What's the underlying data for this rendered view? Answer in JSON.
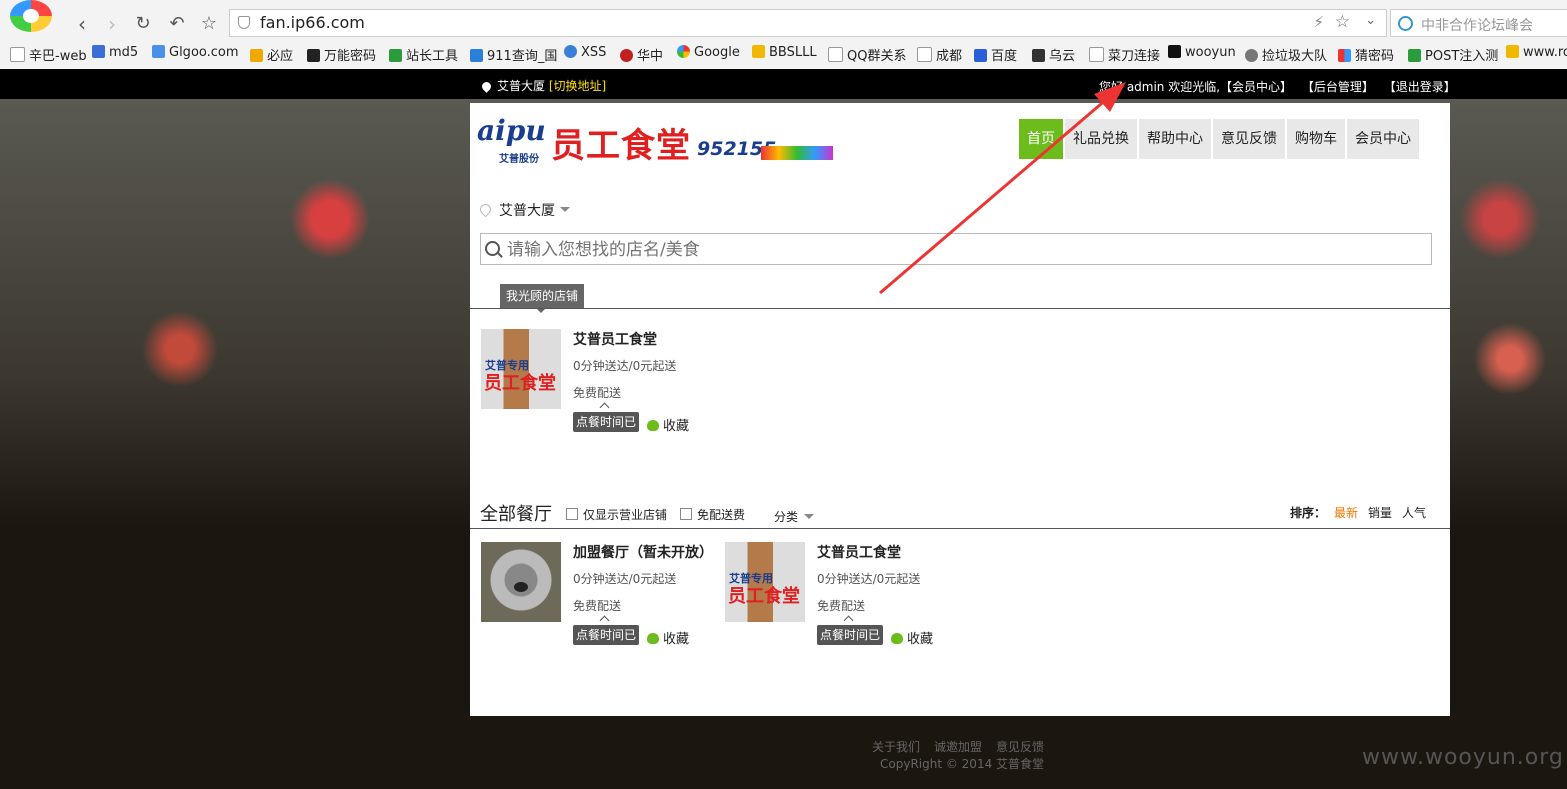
{
  "browser": {
    "url": "fan.ip66.com",
    "search_text": "中非合作论坛峰会",
    "bookmarks": [
      "辛巴-web",
      "md5",
      "Glgoo.com",
      "必应",
      "万能密码",
      "站长工具",
      "911查询_国",
      "XSS",
      "华中",
      "Google",
      "BBSLLL",
      "QQ群关系",
      "成都",
      "百度",
      "乌云",
      "菜刀连接",
      "wooyun",
      "捡垃圾大队",
      "猜密码",
      "POST注入测",
      "www.ro"
    ]
  },
  "topbar": {
    "location": "艾普大厦",
    "switch_link": "[切换地址]",
    "greeting": "您好 admin 欢迎光临,",
    "member_center": "【会员中心】",
    "admin_panel": "【后台管理】",
    "logout": "【退出登录】"
  },
  "site": {
    "logo_latin": "aipu",
    "logo_sub": "艾普股份",
    "logo_title": "员工食堂",
    "logo_phone": "952155"
  },
  "nav": [
    {
      "label": "首页",
      "active": true
    },
    {
      "label": "礼品兑换",
      "active": false
    },
    {
      "label": "帮助中心",
      "active": false
    },
    {
      "label": "意见反馈",
      "active": false
    },
    {
      "label": "购物车",
      "active": false
    },
    {
      "label": "会员中心",
      "active": false
    }
  ],
  "location_select": "艾普大厦",
  "search": {
    "placeholder": "请输入您想找的店名/美食"
  },
  "visited_tag": "我光顾的店铺",
  "visited": [
    {
      "name": "艾普员工食堂",
      "delivery": "0分钟送达/0元起送",
      "fee": "免费配送",
      "status": "点餐时间已",
      "fav": "收藏",
      "thumb_top": "艾普专用",
      "thumb_main": "员工食堂"
    }
  ],
  "all_section": {
    "title": "全部餐厅",
    "open_only": "仅显示营业店铺",
    "free_delivery": "免配送费",
    "category": "分类",
    "sort_label": "排序：",
    "sort_options": [
      "最新",
      "销量",
      "人气"
    ]
  },
  "restaurants": [
    {
      "name": "加盟餐厅（暂未开放）",
      "delivery": "0分钟送达/0元起送",
      "fee": "免费配送",
      "status": "点餐时间已",
      "fav": "收藏"
    },
    {
      "name": "艾普员工食堂",
      "delivery": "0分钟送达/0元起送",
      "fee": "免费配送",
      "status": "点餐时间已",
      "fav": "收藏",
      "thumb_top": "艾普专用",
      "thumb_main": "员工食堂"
    }
  ],
  "footer": {
    "links": [
      "关于我们",
      "诚邀加盟",
      "意见反馈"
    ],
    "copyright": "CopyRight © 2014 艾普食堂"
  },
  "watermark": "www.wooyun.org",
  "colors": {
    "nav_active": "#6cbd1c",
    "sort_active": "#f07a00",
    "annotation_arrow": "#ee3333"
  }
}
